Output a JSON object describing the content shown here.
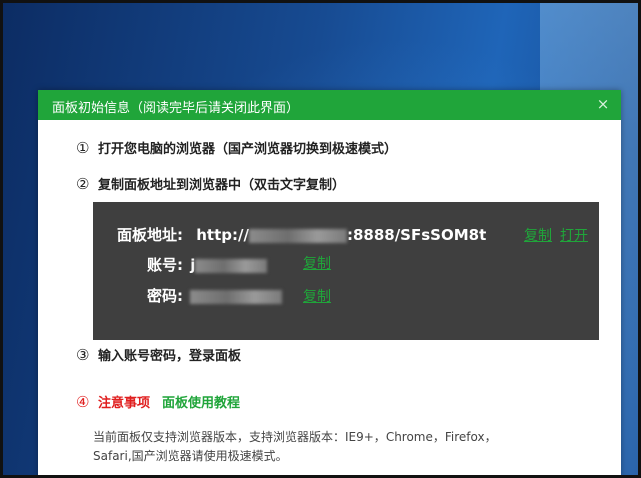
{
  "dialog": {
    "title": "面板初始信息（阅读完毕后请关闭此界面）",
    "close_glyph": "×"
  },
  "steps": [
    {
      "num": "①",
      "text": "打开您电脑的浏览器（国产浏览器切换到极速模式）"
    },
    {
      "num": "②",
      "text": "复制面板地址到浏览器中（双击文字复制）"
    },
    {
      "num": "③",
      "text": "输入账号密码，登录面板"
    }
  ],
  "panel": {
    "address_label": "面板地址:",
    "address_prefix": "http://",
    "address_suffix": ":8888/SFsSOM8t",
    "copy_label": "复制",
    "open_label": "打开",
    "account_label": "账号:",
    "account_prefix": "j",
    "password_label": "密码:",
    "account_copy_label": "复制",
    "password_copy_label": "复制"
  },
  "notice": {
    "num": "④",
    "warning": "注意事项",
    "tutorial_link": "面板使用教程"
  },
  "tip": {
    "line1": "当前面板仅支持浏览器版本，支持浏览器版本：IE9+，Chrome，Firefox，",
    "line2": "Safari,国产浏览器请使用极速模式。"
  },
  "colors": {
    "accent": "#20a53a",
    "warning": "#e02020",
    "panel_bg": "#3f3f3f"
  },
  "icons": [
    "close-icon"
  ]
}
